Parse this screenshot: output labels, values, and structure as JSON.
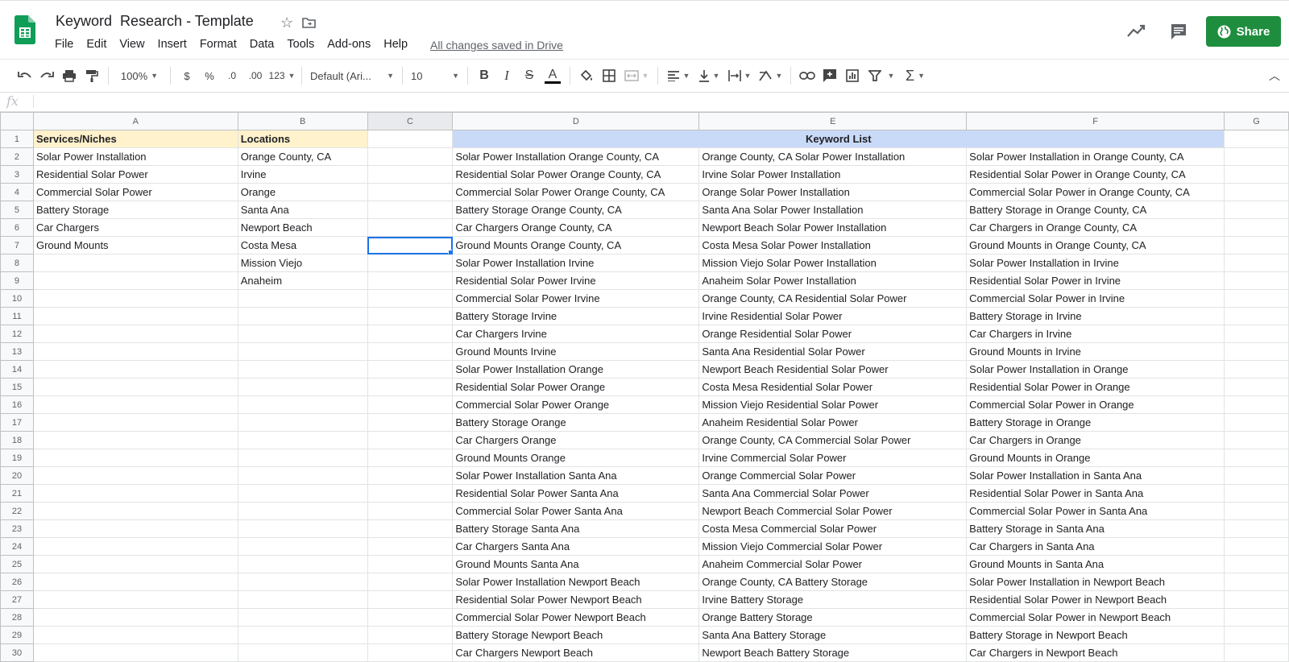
{
  "app": {
    "title": "Keyword  Research - Template",
    "saved_status": "All changes saved in Drive",
    "share_label": "Share"
  },
  "menu": [
    "File",
    "Edit",
    "View",
    "Insert",
    "Format",
    "Data",
    "Tools",
    "Add-ons",
    "Help"
  ],
  "toolbar": {
    "zoom": "100%",
    "currency": "$",
    "percent": "%",
    "dec_decrease": ".0",
    "dec_increase": ".00",
    "more_formats": "123",
    "font": "Default (Ari...",
    "font_size": "10",
    "bold": "B",
    "italic": "I",
    "strike": "S",
    "text_color": "A",
    "text_color_hex": "#000000"
  },
  "formula_bar": {
    "fx": "fx",
    "value": ""
  },
  "columns": [
    "A",
    "B",
    "C",
    "D",
    "E",
    "F",
    "G"
  ],
  "selected_column": "C",
  "header_row": {
    "a": "Services/Niches",
    "b": "Locations",
    "keyword_list": "Keyword List"
  },
  "rows": [
    {
      "n": "2",
      "a": "Solar Power Installation",
      "b": "Orange County, CA",
      "d": "Solar Power Installation Orange County, CA",
      "e": "Orange County, CA Solar Power Installation",
      "f": "Solar Power Installation in Orange County, CA"
    },
    {
      "n": "3",
      "a": "Residential Solar Power",
      "b": "Irvine",
      "d": "Residential Solar Power Orange County, CA",
      "e": "Irvine Solar Power Installation",
      "f": "Residential Solar Power in Orange County, CA"
    },
    {
      "n": "4",
      "a": "Commercial Solar Power",
      "b": "Orange",
      "d": "Commercial Solar Power Orange County, CA",
      "e": "Orange Solar Power Installation",
      "f": "Commercial Solar Power in Orange County, CA"
    },
    {
      "n": "5",
      "a": "Battery Storage",
      "b": "Santa Ana",
      "d": "Battery Storage Orange County, CA",
      "e": "Santa Ana Solar Power Installation",
      "f": "Battery Storage in Orange County, CA"
    },
    {
      "n": "6",
      "a": "Car Chargers",
      "b": "Newport Beach",
      "d": "Car Chargers Orange County, CA",
      "e": "Newport Beach Solar Power Installation",
      "f": "Car Chargers in Orange County, CA"
    },
    {
      "n": "7",
      "a": "Ground Mounts",
      "b": "Costa Mesa",
      "d": "Ground Mounts Orange County, CA",
      "e": "Costa Mesa Solar Power Installation",
      "f": "Ground Mounts in Orange County, CA"
    },
    {
      "n": "8",
      "a": "",
      "b": "Mission Viejo",
      "d": "Solar Power Installation Irvine",
      "e": "Mission Viejo Solar Power Installation",
      "f": "Solar Power Installation in Irvine"
    },
    {
      "n": "9",
      "a": "",
      "b": "Anaheim",
      "d": "Residential Solar Power Irvine",
      "e": "Anaheim Solar Power Installation",
      "f": "Residential Solar Power in Irvine"
    },
    {
      "n": "10",
      "a": "",
      "b": "",
      "d": "Commercial Solar Power Irvine",
      "e": "Orange County, CA Residential Solar Power",
      "f": "Commercial Solar Power in Irvine"
    },
    {
      "n": "11",
      "a": "",
      "b": "",
      "d": "Battery Storage Irvine",
      "e": "Irvine Residential Solar Power",
      "f": "Battery Storage in Irvine"
    },
    {
      "n": "12",
      "a": "",
      "b": "",
      "d": "Car Chargers Irvine",
      "e": "Orange Residential Solar Power",
      "f": "Car Chargers in Irvine"
    },
    {
      "n": "13",
      "a": "",
      "b": "",
      "d": "Ground Mounts Irvine",
      "e": "Santa Ana Residential Solar Power",
      "f": "Ground Mounts in Irvine"
    },
    {
      "n": "14",
      "a": "",
      "b": "",
      "d": "Solar Power Installation Orange",
      "e": "Newport Beach Residential Solar Power",
      "f": "Solar Power Installation in Orange"
    },
    {
      "n": "15",
      "a": "",
      "b": "",
      "d": "Residential Solar Power Orange",
      "e": "Costa Mesa Residential Solar Power",
      "f": "Residential Solar Power in Orange"
    },
    {
      "n": "16",
      "a": "",
      "b": "",
      "d": "Commercial Solar Power Orange",
      "e": "Mission Viejo Residential Solar Power",
      "f": "Commercial Solar Power in Orange"
    },
    {
      "n": "17",
      "a": "",
      "b": "",
      "d": "Battery Storage Orange",
      "e": "Anaheim Residential Solar Power",
      "f": "Battery Storage in Orange"
    },
    {
      "n": "18",
      "a": "",
      "b": "",
      "d": "Car Chargers Orange",
      "e": "Orange County, CA Commercial Solar Power",
      "f": "Car Chargers in Orange"
    },
    {
      "n": "19",
      "a": "",
      "b": "",
      "d": "Ground Mounts Orange",
      "e": "Irvine Commercial Solar Power",
      "f": "Ground Mounts in Orange"
    },
    {
      "n": "20",
      "a": "",
      "b": "",
      "d": "Solar Power Installation Santa Ana",
      "e": "Orange Commercial Solar Power",
      "f": "Solar Power Installation in Santa Ana"
    },
    {
      "n": "21",
      "a": "",
      "b": "",
      "d": "Residential Solar Power Santa Ana",
      "e": "Santa Ana Commercial Solar Power",
      "f": "Residential Solar Power in Santa Ana"
    },
    {
      "n": "22",
      "a": "",
      "b": "",
      "d": "Commercial Solar Power Santa Ana",
      "e": "Newport Beach Commercial Solar Power",
      "f": "Commercial Solar Power in Santa Ana"
    },
    {
      "n": "23",
      "a": "",
      "b": "",
      "d": "Battery Storage Santa Ana",
      "e": "Costa Mesa Commercial Solar Power",
      "f": "Battery Storage in Santa Ana"
    },
    {
      "n": "24",
      "a": "",
      "b": "",
      "d": "Car Chargers Santa Ana",
      "e": "Mission Viejo Commercial Solar Power",
      "f": "Car Chargers in Santa Ana"
    },
    {
      "n": "25",
      "a": "",
      "b": "",
      "d": "Ground Mounts Santa Ana",
      "e": "Anaheim Commercial Solar Power",
      "f": "Ground Mounts in Santa Ana"
    },
    {
      "n": "26",
      "a": "",
      "b": "",
      "d": "Solar Power Installation Newport Beach",
      "e": "Orange County, CA Battery Storage",
      "f": "Solar Power Installation in Newport Beach"
    },
    {
      "n": "27",
      "a": "",
      "b": "",
      "d": "Residential Solar Power Newport Beach",
      "e": "Irvine Battery Storage",
      "f": "Residential Solar Power in Newport Beach"
    },
    {
      "n": "28",
      "a": "",
      "b": "",
      "d": "Commercial Solar Power Newport Beach",
      "e": "Orange Battery Storage",
      "f": "Commercial Solar Power in Newport Beach"
    },
    {
      "n": "29",
      "a": "",
      "b": "",
      "d": "Battery Storage Newport Beach",
      "e": "Santa Ana Battery Storage",
      "f": "Battery Storage in Newport Beach"
    },
    {
      "n": "30",
      "a": "",
      "b": "",
      "d": "Car Chargers Newport Beach",
      "e": "Newport Beach Battery Storage",
      "f": "Car Chargers in Newport Beach"
    }
  ],
  "colors": {
    "header_yellow": "#fff2cc",
    "header_blue": "#c9daf8",
    "share_green": "#1e8e3e",
    "selection": "#1a73e8"
  },
  "selected_cell": "C7"
}
